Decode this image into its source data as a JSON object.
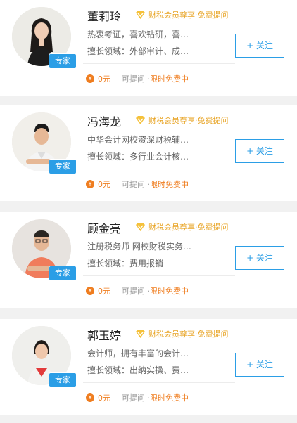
{
  "colors": {
    "accent": "#2b9ee6",
    "orange": "#ef7d1f",
    "gold": "#e8a425"
  },
  "experts": [
    {
      "name": "董莉玲",
      "badge": "专家",
      "vip_text": "财税会员尊享·免费提问",
      "desc": "热衷考证，喜欢钻研，喜…",
      "field": "擅长领域：外部审计、成…",
      "follow": "+ 关注",
      "price": "0元",
      "askable": "可提问 ·",
      "free": "限时免费中"
    },
    {
      "name": "冯海龙",
      "badge": "专家",
      "vip_text": "财税会员尊享·免费提问",
      "desc": "中华会计网校资深财税辅…",
      "field": "擅长领域：多行业会计核…",
      "follow": "+ 关注",
      "price": "0元",
      "askable": "可提问 ·",
      "free": "限时免费中"
    },
    {
      "name": "顾金亮",
      "badge": "专家",
      "vip_text": "财税会员尊享·免费提问",
      "desc": "注册税务师 网校财税实务…",
      "field": "擅长领域：费用报销",
      "follow": "+ 关注",
      "price": "0元",
      "askable": "可提问 ·",
      "free": "限时免费中"
    },
    {
      "name": "郭玉婷",
      "badge": "专家",
      "vip_text": "财税会员尊享·免费提问",
      "desc": "会计师，拥有丰富的会计…",
      "field": "擅长领域：出纳实操、费…",
      "follow": "+ 关注",
      "price": "0元",
      "askable": "可提问 ·",
      "free": "限时免费中"
    }
  ]
}
